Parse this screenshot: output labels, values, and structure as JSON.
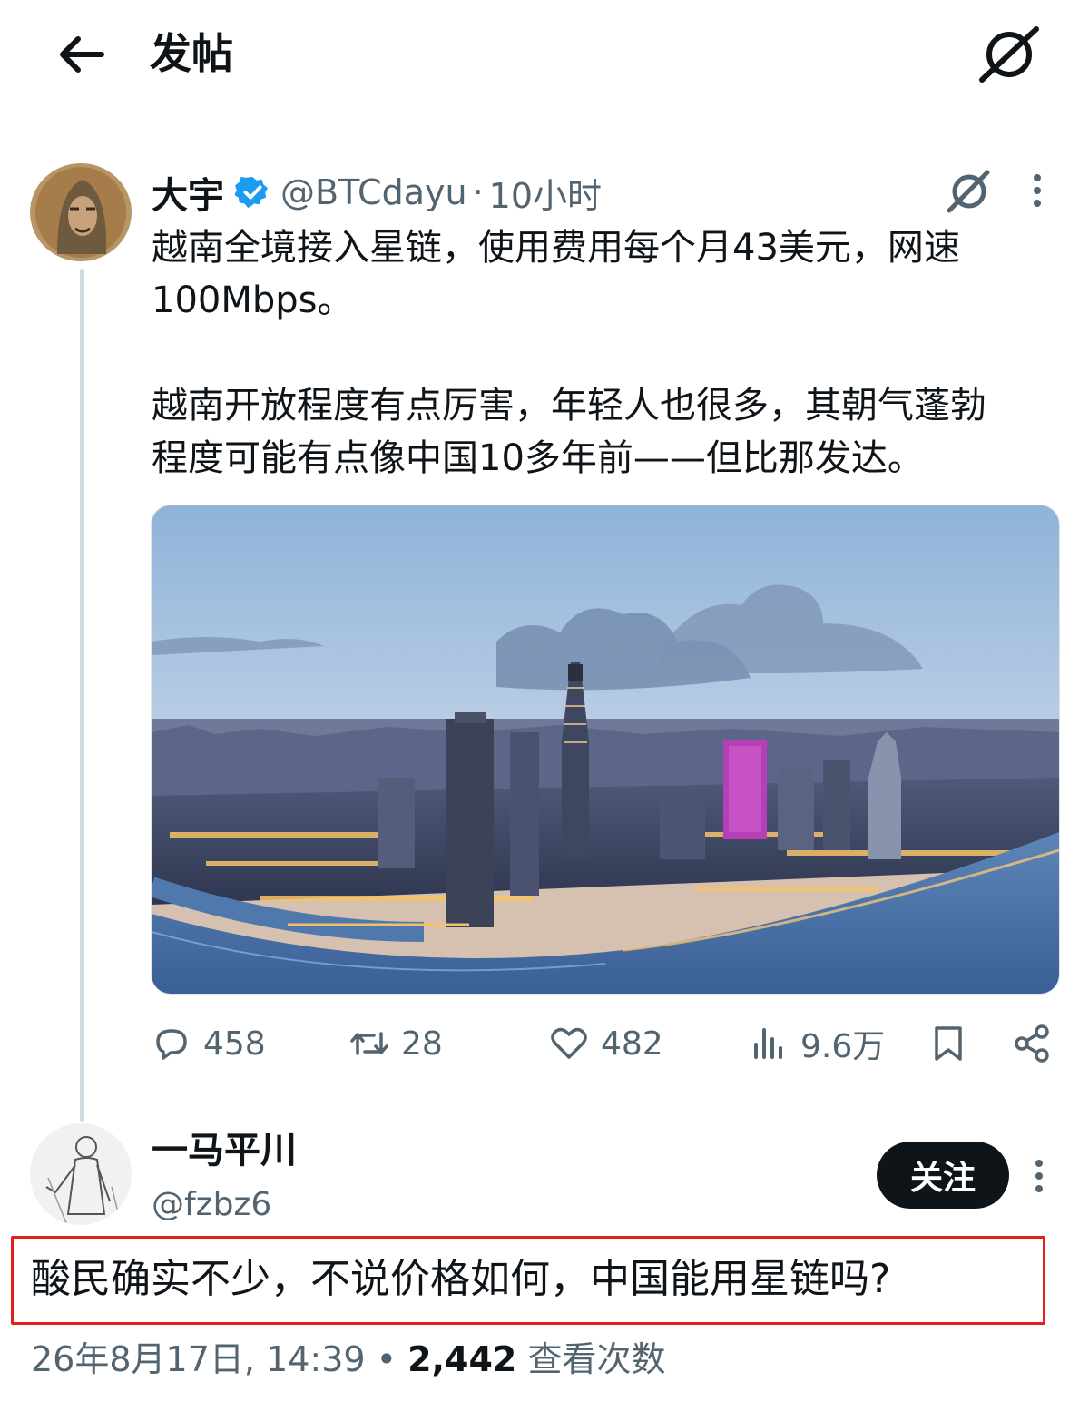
{
  "header": {
    "title": "发帖"
  },
  "tweet": {
    "name": "大宇",
    "handle": "@BTCdayu",
    "separator": "·",
    "time": "10小时",
    "text_lines": [
      "越南全境接入星链，使用费用每个月43美元，网速",
      "100Mbps。",
      "越南开放程度有点厉害，年轻人也很多，其朝气蓬勃",
      "程度可能有点像中国10多年前——但比那发达。"
    ],
    "actions": {
      "replies": "458",
      "retweets": "28",
      "likes": "482",
      "views": "9.6万"
    }
  },
  "reply": {
    "name": "一马平川",
    "handle": "@fzbz6",
    "follow_label": "关注",
    "text": "酸民确实不少，不说价格如何，中国能用星链吗?",
    "date": "26年8月17日, 14:39",
    "dot": "•",
    "view_count": "2,442",
    "view_label": "查看次数"
  },
  "colors": {
    "text": "#0f1419",
    "secondary": "#536471",
    "verified": "#1d9bf0",
    "highlight_border": "#e0201b",
    "thread_line": "#cfd9de",
    "follow_bg": "#0f1419"
  },
  "icons": [
    "back-arrow-icon",
    "grok-icon",
    "verified-badge-icon",
    "more-icon",
    "reply-icon",
    "retweet-icon",
    "like-icon",
    "views-icon",
    "bookmark-icon",
    "share-icon"
  ]
}
